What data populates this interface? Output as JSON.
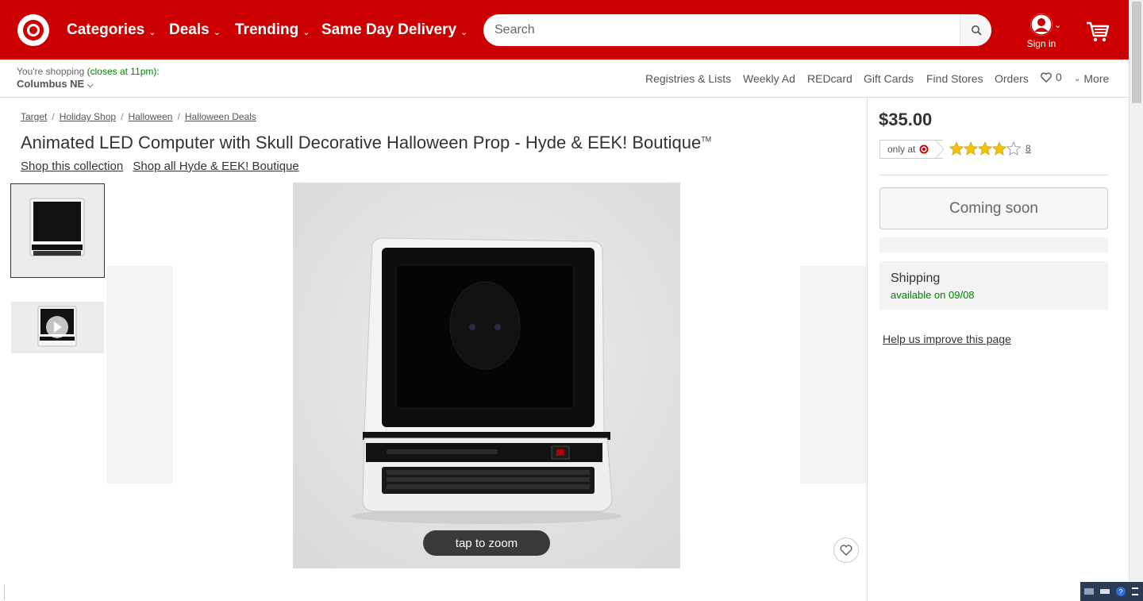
{
  "header": {
    "nav": [
      {
        "label": "Categories"
      },
      {
        "label": "Deals"
      },
      {
        "label": "Trending"
      },
      {
        "label": "Same Day Delivery"
      }
    ],
    "search_placeholder": "Search",
    "signin_label": "Sign in",
    "brand_color": "#cc0000"
  },
  "subheader": {
    "shopping_prefix": "You're shopping",
    "hours": "(closes at 11pm):",
    "store_name": "Columbus NE",
    "links": [
      "Registries & Lists",
      "Weekly Ad",
      "REDcard",
      "Gift Cards",
      "Find Stores",
      "Orders"
    ],
    "favorites_count": "0",
    "more_label": "More"
  },
  "breadcrumb": [
    "Target",
    "Holiday Shop",
    "Halloween",
    "Halloween Deals"
  ],
  "product": {
    "title": "Animated LED Computer with Skull Decorative Halloween Prop - Hyde & EEK! Boutique",
    "trademark": "TM",
    "collection_link": "Shop this collection",
    "brand_link": "Shop all Hyde & EEK! Boutique",
    "zoom_label": "tap to zoom"
  },
  "buybox": {
    "price": "$35.00",
    "only_at": "only at",
    "rating": 4,
    "rating_max": 5,
    "review_count": "8",
    "button_label": "Coming soon",
    "shipping_title": "Shipping",
    "shipping_status": "available on 09/08",
    "help_link": "Help us improve this page"
  },
  "icons": {
    "logo": "target-bullseye-icon",
    "search": "search-icon",
    "account": "user-icon",
    "cart": "cart-icon",
    "heart": "heart-icon"
  }
}
